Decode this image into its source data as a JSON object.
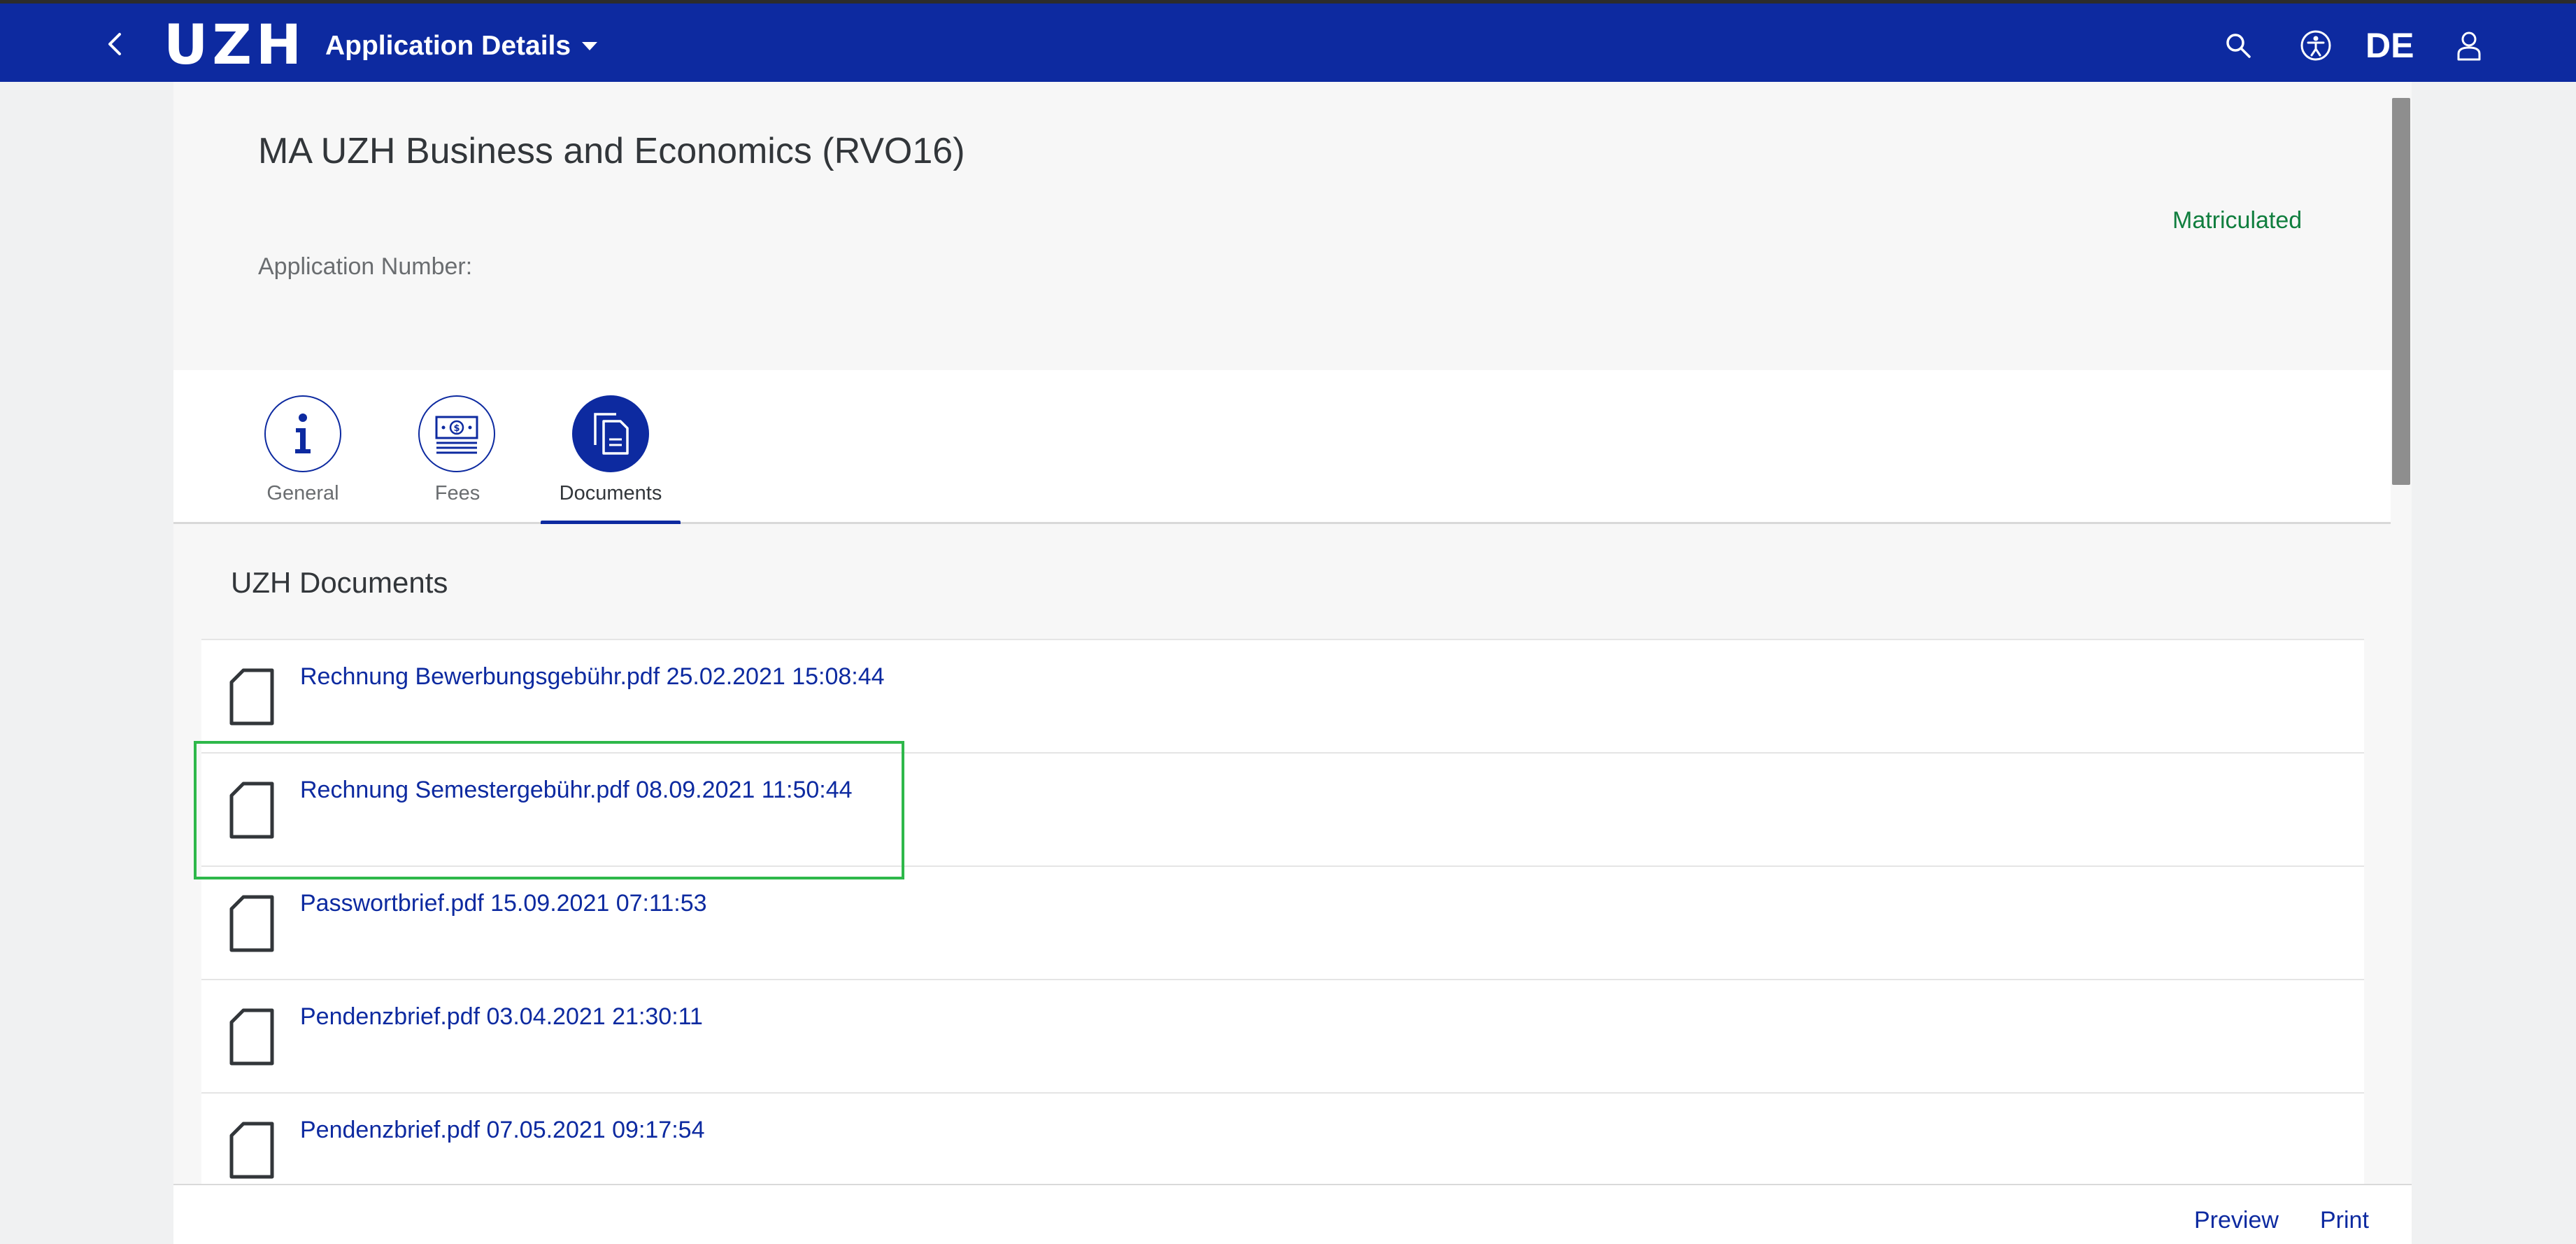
{
  "shell": {
    "logo": "UZH",
    "app_title": "Application Details",
    "language": "DE"
  },
  "header": {
    "title": "MA UZH Business and Economics (RVO16)",
    "app_number_label": "Application Number:",
    "app_number_value": "",
    "status": "Matriculated"
  },
  "tabs": [
    {
      "label": "General",
      "icon": "info-icon"
    },
    {
      "label": "Fees",
      "icon": "money-bills-icon"
    },
    {
      "label": "Documents",
      "icon": "documents-icon",
      "active": true
    }
  ],
  "section": {
    "title": "UZH Documents",
    "documents": [
      {
        "text": "Rechnung Bewerbungsgebühr.pdf 25.02.2021 15:08:44"
      },
      {
        "text": "Rechnung Semestergebühr.pdf 08.09.2021 11:50:44"
      },
      {
        "text": "Passwortbrief.pdf 15.09.2021 07:11:53"
      },
      {
        "text": "Pendenzbrief.pdf 03.04.2021 21:30:11"
      },
      {
        "text": "Pendenzbrief.pdf 07.05.2021 09:17:54"
      }
    ]
  },
  "footer": {
    "preview_label": "Preview",
    "print_label": "Print"
  },
  "colors": {
    "shell_bg": "#0d2aa0",
    "link": "#0d2aa0",
    "status_positive": "#107e3e",
    "highlight": "#2eb84a"
  }
}
